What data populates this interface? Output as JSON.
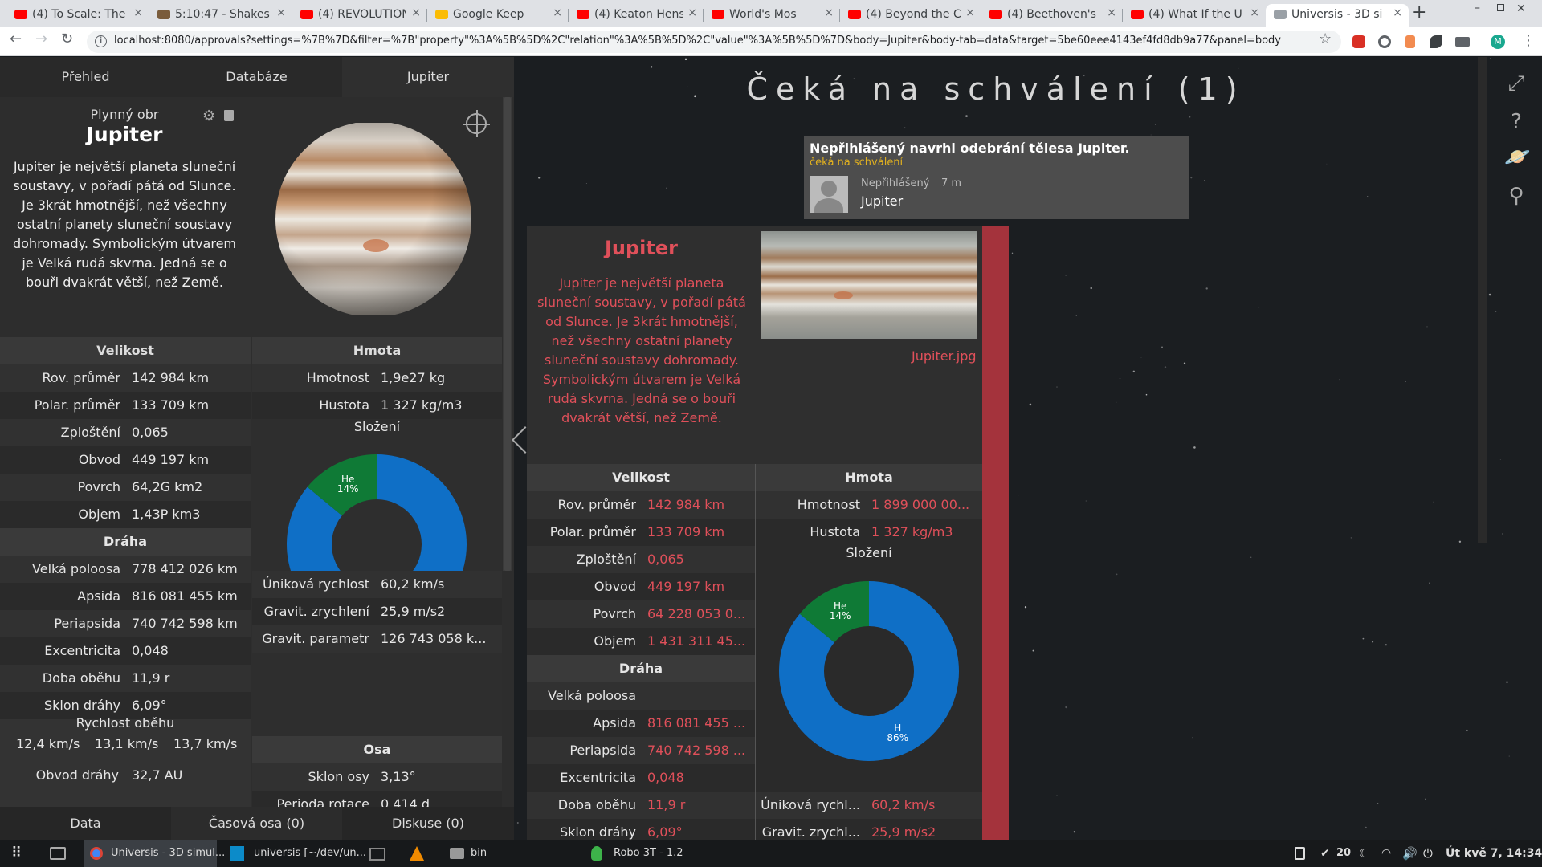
{
  "browser": {
    "tabs": [
      {
        "title": "(4) To Scale: The",
        "icon": "youtube-icon",
        "color": "#ff0000"
      },
      {
        "title": "5:10:47 - Shakes",
        "icon": "audio-icon",
        "color": "#7a5c3c"
      },
      {
        "title": "(4) REVOLUTION",
        "icon": "youtube-icon",
        "color": "#ff0000"
      },
      {
        "title": "Google Keep",
        "icon": "keep-icon",
        "color": "#fbbc04"
      },
      {
        "title": "(4) Keaton Hens",
        "icon": "youtube-icon",
        "color": "#ff0000"
      },
      {
        "title": "World's Mos",
        "icon": "youtube-icon",
        "color": "#ff0000"
      },
      {
        "title": "(4) Beyond the C",
        "icon": "youtube-icon",
        "color": "#ff0000"
      },
      {
        "title": "(4) Beethoven's",
        "icon": "youtube-icon",
        "color": "#ff0000"
      },
      {
        "title": "(4) What If the U",
        "icon": "youtube-icon",
        "color": "#ff0000"
      },
      {
        "title": "Universis - 3D si",
        "icon": "page-icon",
        "color": "#9aa0a6"
      }
    ],
    "url": "localhost:8080/approvals?settings=%7B%7D&filter=%7B\"property\"%3A%5B%5D%2C\"relation\"%3A%5B%5D%2C\"value\"%3A%5B%5D%7D&body=Jupiter&body-tab=data&target=5be60eee4143ef4fd8db9a77&panel=body",
    "profile_letter": "M"
  },
  "left": {
    "tabs": [
      "Přehled",
      "Databáze",
      "Jupiter"
    ],
    "subtitle": "Plynný obr",
    "name": "Jupiter",
    "description": "Jupiter je největší planeta sluneční soustavy, v pořadí pátá od Slunce. Je 3krát hmotnější, než všechny ostatní planety sluneční soustavy dohromady. Symbolickým útvarem je Velká rudá skvrna. Jedná se o bouři dvakrát větší, než Země.",
    "size_header": "Velikost",
    "size": [
      {
        "k": "Rov. průměr",
        "v": "142 984 km"
      },
      {
        "k": "Polar. průměr",
        "v": "133 709 km"
      },
      {
        "k": "Zploštění",
        "v": "0,065"
      },
      {
        "k": "Obvod",
        "v": "449 197 km"
      },
      {
        "k": "Povrch",
        "v": "64,2G km2"
      },
      {
        "k": "Objem",
        "v": "1,43P km3"
      }
    ],
    "orbit_header": "Dráha",
    "orbit": [
      {
        "k": "Velká poloosa",
        "v": "778 412 026 km"
      },
      {
        "k": "Apsida",
        "v": "816 081 455 km"
      },
      {
        "k": "Periapsida",
        "v": "740 742 598 km"
      },
      {
        "k": "Excentricita",
        "v": "0,048"
      },
      {
        "k": "Doba oběhu",
        "v": "11,9 r"
      },
      {
        "k": "Sklon dráhy",
        "v": "6,09°"
      }
    ],
    "speed_header": "Rychlost oběhu",
    "speeds": [
      "12,4 km/s",
      "13,1 km/s",
      "13,7 km/s"
    ],
    "orbit_len": {
      "k": "Obvod dráhy",
      "v": "32,7 AU"
    },
    "mass_header": "Hmota",
    "mass": [
      {
        "k": "Hmotnost",
        "v": "1,9e27 kg"
      },
      {
        "k": "Hustota",
        "v": "1 327 kg/m3"
      }
    ],
    "composition_label": "Složení",
    "mass2": [
      {
        "k": "Úniková rychlost",
        "v": "60,2 km/s"
      },
      {
        "k": "Gravit. zrychlení",
        "v": "25,9 m/s2"
      },
      {
        "k": "Gravit. parametr",
        "v": "126 743 058 k..."
      }
    ],
    "axis_header": "Osa",
    "axis": [
      {
        "k": "Sklon osy",
        "v": "3,13°"
      },
      {
        "k": "Perioda rotace",
        "v": "0,414 d"
      }
    ],
    "bottom_tabs": [
      "Data",
      "Časová osa (0)",
      "Diskuse (0)"
    ]
  },
  "chart_data": {
    "type": "pie",
    "categories": [
      "H",
      "He"
    ],
    "values": [
      86,
      14
    ],
    "labels": [
      "86%",
      "14%"
    ],
    "colors": [
      "#0f6fc6",
      "#0f7a36"
    ]
  },
  "main": {
    "title": "Čeká na schválení (1)",
    "notification": {
      "text": "Nepřihlášený navrhl odebrání tělesa Jupiter.",
      "status": "čeká na schválení",
      "user": "Nepřihlášený",
      "time": "7 m",
      "body": "Jupiter"
    },
    "card": {
      "name": "Jupiter",
      "description": "Jupiter je největší planeta sluneční soustavy, v pořadí pátá od Slunce. Je 3krát hmotnější, než všechny ostatní planety sluneční soustavy dohromady. Symbolickým útvarem je Velká rudá skvrna. Jedná se o bouři dvakrát větší, než Země.",
      "image_file": "Jupiter.jpg",
      "size_header": "Velikost",
      "size": [
        {
          "k": "Rov. průměr",
          "v": "142 984 km"
        },
        {
          "k": "Polar. průměr",
          "v": "133 709 km"
        },
        {
          "k": "Zploštění",
          "v": "0,065"
        },
        {
          "k": "Obvod",
          "v": "449 197 km"
        },
        {
          "k": "Povrch",
          "v": "64 228 053 0..."
        },
        {
          "k": "Objem",
          "v": "1 431 311 45..."
        }
      ],
      "orbit_header": "Dráha",
      "orbit": [
        {
          "k": "Velká poloosa",
          "v": ""
        },
        {
          "k": "Apsida",
          "v": "816 081 455 ..."
        },
        {
          "k": "Periapsida",
          "v": "740 742 598 ..."
        },
        {
          "k": "Excentricita",
          "v": "0,048"
        },
        {
          "k": "Doba oběhu",
          "v": "11,9 r"
        },
        {
          "k": "Sklon dráhy",
          "v": "6,09°"
        }
      ],
      "mass_header": "Hmota",
      "mass": [
        {
          "k": "Hmotnost",
          "v": "1 899 000 00..."
        },
        {
          "k": "Hustota",
          "v": "1 327 kg/m3"
        }
      ],
      "composition_label": "Složení",
      "mass2": [
        {
          "k": "Úniková rychl...",
          "v": "60,2 km/s"
        },
        {
          "k": "Gravit. zrychl...",
          "v": "25,9 m/s2"
        }
      ]
    }
  },
  "taskbar": {
    "items": [
      "Universis - 3D simul...",
      "universis [~/dev/un...",
      "bin",
      "Robo 3T - 1.2"
    ],
    "badge": "20",
    "clock": "Út kvě 7, 14:34"
  }
}
